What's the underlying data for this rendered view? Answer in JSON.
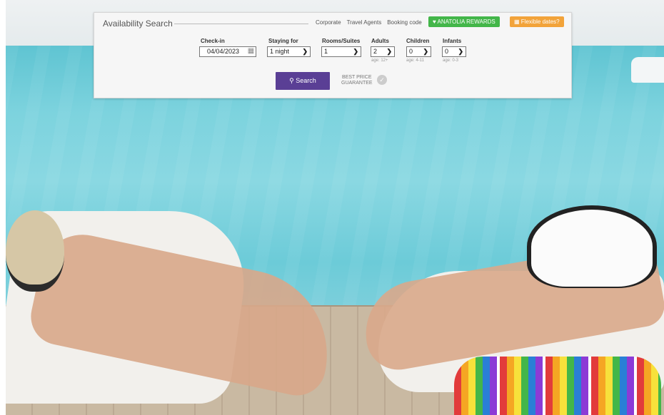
{
  "search": {
    "title": "Availability Search",
    "links": [
      "Corporate",
      "Travel Agents",
      "Booking code"
    ],
    "rewards_label": "ANATOLIA REWARDS",
    "flexible_label": "Flexible dates?",
    "checkin_label": "Check-in",
    "checkin_value": "04/04/2023",
    "staying_label": "Staying for",
    "staying_value": "1 night",
    "rooms_label": "Rooms/Suites",
    "rooms_value": "1",
    "adults_label": "Adults",
    "adults_value": "2",
    "adults_hint": "age: 12+",
    "children_label": "Children",
    "children_value": "0",
    "children_hint": "age: 4-11",
    "infants_label": "Infants",
    "infants_value": "0",
    "infants_hint": "age: 0-3",
    "search_label": "Search",
    "best_price_line1": "BEST PRICE",
    "best_price_line2": "GUARANTEE"
  },
  "icons": {
    "calendar": "calendar-icon",
    "search": "search-icon",
    "heart": "heart-icon",
    "check": "check-icon",
    "chevron": "chevron-down-icon"
  },
  "colors": {
    "brand_purple": "#5a3f95",
    "rewards_green": "#43b649",
    "flex_orange": "#f2a33a"
  }
}
